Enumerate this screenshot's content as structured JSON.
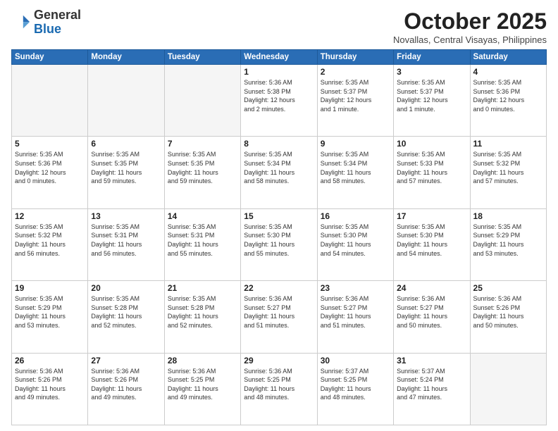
{
  "header": {
    "logo_line1": "General",
    "logo_line2": "Blue",
    "month": "October 2025",
    "location": "Novallas, Central Visayas, Philippines"
  },
  "days_of_week": [
    "Sunday",
    "Monday",
    "Tuesday",
    "Wednesday",
    "Thursday",
    "Friday",
    "Saturday"
  ],
  "weeks": [
    [
      {
        "day": "",
        "info": ""
      },
      {
        "day": "",
        "info": ""
      },
      {
        "day": "",
        "info": ""
      },
      {
        "day": "1",
        "info": "Sunrise: 5:36 AM\nSunset: 5:38 PM\nDaylight: 12 hours\nand 2 minutes."
      },
      {
        "day": "2",
        "info": "Sunrise: 5:35 AM\nSunset: 5:37 PM\nDaylight: 12 hours\nand 1 minute."
      },
      {
        "day": "3",
        "info": "Sunrise: 5:35 AM\nSunset: 5:37 PM\nDaylight: 12 hours\nand 1 minute."
      },
      {
        "day": "4",
        "info": "Sunrise: 5:35 AM\nSunset: 5:36 PM\nDaylight: 12 hours\nand 0 minutes."
      }
    ],
    [
      {
        "day": "5",
        "info": "Sunrise: 5:35 AM\nSunset: 5:36 PM\nDaylight: 12 hours\nand 0 minutes."
      },
      {
        "day": "6",
        "info": "Sunrise: 5:35 AM\nSunset: 5:35 PM\nDaylight: 11 hours\nand 59 minutes."
      },
      {
        "day": "7",
        "info": "Sunrise: 5:35 AM\nSunset: 5:35 PM\nDaylight: 11 hours\nand 59 minutes."
      },
      {
        "day": "8",
        "info": "Sunrise: 5:35 AM\nSunset: 5:34 PM\nDaylight: 11 hours\nand 58 minutes."
      },
      {
        "day": "9",
        "info": "Sunrise: 5:35 AM\nSunset: 5:34 PM\nDaylight: 11 hours\nand 58 minutes."
      },
      {
        "day": "10",
        "info": "Sunrise: 5:35 AM\nSunset: 5:33 PM\nDaylight: 11 hours\nand 57 minutes."
      },
      {
        "day": "11",
        "info": "Sunrise: 5:35 AM\nSunset: 5:32 PM\nDaylight: 11 hours\nand 57 minutes."
      }
    ],
    [
      {
        "day": "12",
        "info": "Sunrise: 5:35 AM\nSunset: 5:32 PM\nDaylight: 11 hours\nand 56 minutes."
      },
      {
        "day": "13",
        "info": "Sunrise: 5:35 AM\nSunset: 5:31 PM\nDaylight: 11 hours\nand 56 minutes."
      },
      {
        "day": "14",
        "info": "Sunrise: 5:35 AM\nSunset: 5:31 PM\nDaylight: 11 hours\nand 55 minutes."
      },
      {
        "day": "15",
        "info": "Sunrise: 5:35 AM\nSunset: 5:30 PM\nDaylight: 11 hours\nand 55 minutes."
      },
      {
        "day": "16",
        "info": "Sunrise: 5:35 AM\nSunset: 5:30 PM\nDaylight: 11 hours\nand 54 minutes."
      },
      {
        "day": "17",
        "info": "Sunrise: 5:35 AM\nSunset: 5:30 PM\nDaylight: 11 hours\nand 54 minutes."
      },
      {
        "day": "18",
        "info": "Sunrise: 5:35 AM\nSunset: 5:29 PM\nDaylight: 11 hours\nand 53 minutes."
      }
    ],
    [
      {
        "day": "19",
        "info": "Sunrise: 5:35 AM\nSunset: 5:29 PM\nDaylight: 11 hours\nand 53 minutes."
      },
      {
        "day": "20",
        "info": "Sunrise: 5:35 AM\nSunset: 5:28 PM\nDaylight: 11 hours\nand 52 minutes."
      },
      {
        "day": "21",
        "info": "Sunrise: 5:35 AM\nSunset: 5:28 PM\nDaylight: 11 hours\nand 52 minutes."
      },
      {
        "day": "22",
        "info": "Sunrise: 5:36 AM\nSunset: 5:27 PM\nDaylight: 11 hours\nand 51 minutes."
      },
      {
        "day": "23",
        "info": "Sunrise: 5:36 AM\nSunset: 5:27 PM\nDaylight: 11 hours\nand 51 minutes."
      },
      {
        "day": "24",
        "info": "Sunrise: 5:36 AM\nSunset: 5:27 PM\nDaylight: 11 hours\nand 50 minutes."
      },
      {
        "day": "25",
        "info": "Sunrise: 5:36 AM\nSunset: 5:26 PM\nDaylight: 11 hours\nand 50 minutes."
      }
    ],
    [
      {
        "day": "26",
        "info": "Sunrise: 5:36 AM\nSunset: 5:26 PM\nDaylight: 11 hours\nand 49 minutes."
      },
      {
        "day": "27",
        "info": "Sunrise: 5:36 AM\nSunset: 5:26 PM\nDaylight: 11 hours\nand 49 minutes."
      },
      {
        "day": "28",
        "info": "Sunrise: 5:36 AM\nSunset: 5:25 PM\nDaylight: 11 hours\nand 49 minutes."
      },
      {
        "day": "29",
        "info": "Sunrise: 5:36 AM\nSunset: 5:25 PM\nDaylight: 11 hours\nand 48 minutes."
      },
      {
        "day": "30",
        "info": "Sunrise: 5:37 AM\nSunset: 5:25 PM\nDaylight: 11 hours\nand 48 minutes."
      },
      {
        "day": "31",
        "info": "Sunrise: 5:37 AM\nSunset: 5:24 PM\nDaylight: 11 hours\nand 47 minutes."
      },
      {
        "day": "",
        "info": ""
      }
    ]
  ]
}
